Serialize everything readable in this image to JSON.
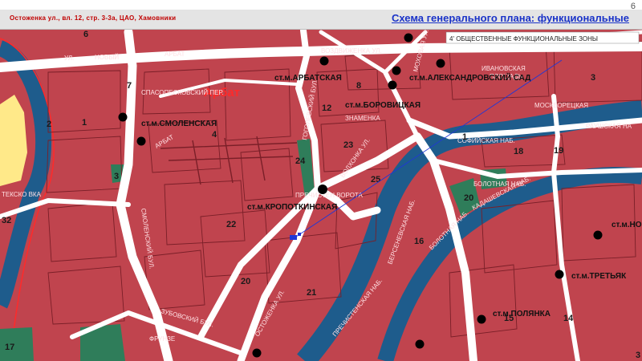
{
  "page_number": "6",
  "header": {
    "address": "Остоженка ул., вл. 12, стр. 3-3а, ЦАО, Хамовники",
    "title": "Схема генерального плана: функциональные"
  },
  "legend_label": "4' ОБЩЕСТВЕННЫЕ ФУНКЦИОНАЛЬНЫЕ ЗОНЫ",
  "colors": {
    "zone": "#c0444e",
    "road": "#ffffff",
    "river": "#1e5c8c",
    "park": "#2f7d5a",
    "block_line": "#7a1f28",
    "highlight": "#ffe989",
    "marker": "#1f37d6"
  },
  "district_label": "Арбат",
  "metro_stations": [
    "ст.м.АРБАТСКАЯ",
    "ст.м.АЛЕКСАНДРОВСКИЙ САД",
    "ст.м.БОРОВИЦКАЯ",
    "ст.м.СМОЛЕНСКАЯ",
    "ст.м.КРОПОТКИНСКАЯ",
    "ст.м.НО",
    "ст.м.ТРЕТЬЯК",
    "ст.м.ПОЛЯНКА"
  ],
  "street_labels": [
    "УЛ.",
    "НОВЫЙ",
    "АРБАТ",
    "ВОЗДВИЖЕНКА УЛ.",
    "МОХОВАЯ УЛ.",
    "ИВАНОВСКАЯ",
    "ПЛОЩАДЬ",
    "СПАСОПЕСКОВСКИЙ ПЕР.",
    "МОСКВОРЕЦКАЯ",
    "РАУШСКАЯ НА",
    "СОФИЙСКАЯ НАБ.",
    "БОЛОТНАЯ НАБ.",
    "КАДАШЕВСКАЯ НАБ.",
    "БЕРСЕНЕВСКАЯ НАБ.",
    "БОЛОТНАЯ НАБ.",
    "СМОЛЕНСКИЙ БУЛ.",
    "ЗУБОВСКИЙ БУЛ.",
    "ВОЛХОНКА УЛ.",
    "ГОГОЛЕВСКИЙ БУЛ.",
    "ПРЕЧИСТЕН ВОРОТА",
    "ЗНАМЕНКА",
    "ОСТОЖЕНКА УЛ.",
    "ФРУНЗЕ",
    "АРБАТ",
    "ТЕКСКО ВКА",
    "ПРЕЧИСТЕНСКАЯ НАБ."
  ],
  "zone_numbers": [
    "6",
    "7",
    "8",
    "12",
    "1",
    "2",
    "3",
    "4",
    "3",
    "23",
    "24",
    "25",
    "22",
    "20",
    "21",
    "16",
    "18",
    "19",
    "20",
    "15",
    "14",
    "17",
    "32",
    "3",
    "1"
  ]
}
